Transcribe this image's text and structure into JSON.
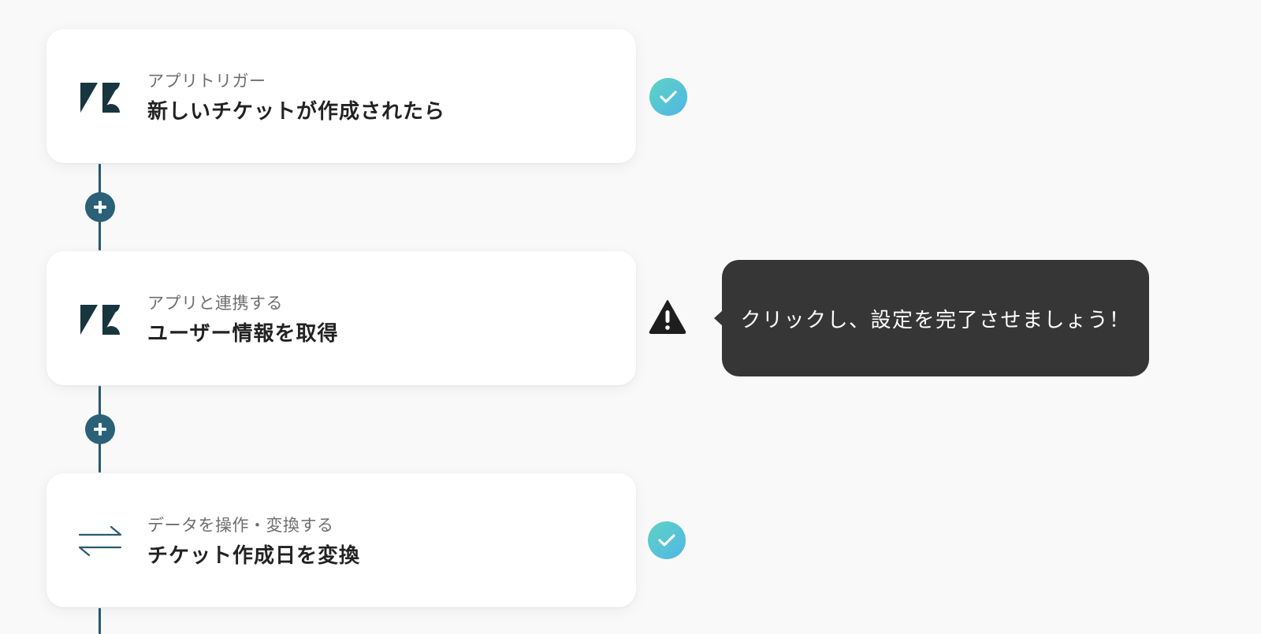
{
  "steps": [
    {
      "subtitle": "アプリトリガー",
      "title": "新しいチケットが作成されたら",
      "icon": "zendesk-logo-icon",
      "status": "complete"
    },
    {
      "subtitle": "アプリと連携する",
      "title": "ユーザー情報を取得",
      "icon": "zendesk-logo-icon",
      "status": "warning"
    },
    {
      "subtitle": "データを操作・変換する",
      "title": "チケット作成日を変換",
      "icon": "convert-arrows-icon",
      "status": "complete"
    }
  ],
  "tooltip": {
    "text": "クリックし、設定を完了させましょう！"
  },
  "colors": {
    "background": "#f9f9f9",
    "connector": "#28586f",
    "add_button": "#2b6079",
    "check_gradient_start": "#5fd3c4",
    "check_gradient_end": "#4fb6e6",
    "zendesk_logo": "#17363f",
    "tooltip_bg": "#363636"
  }
}
